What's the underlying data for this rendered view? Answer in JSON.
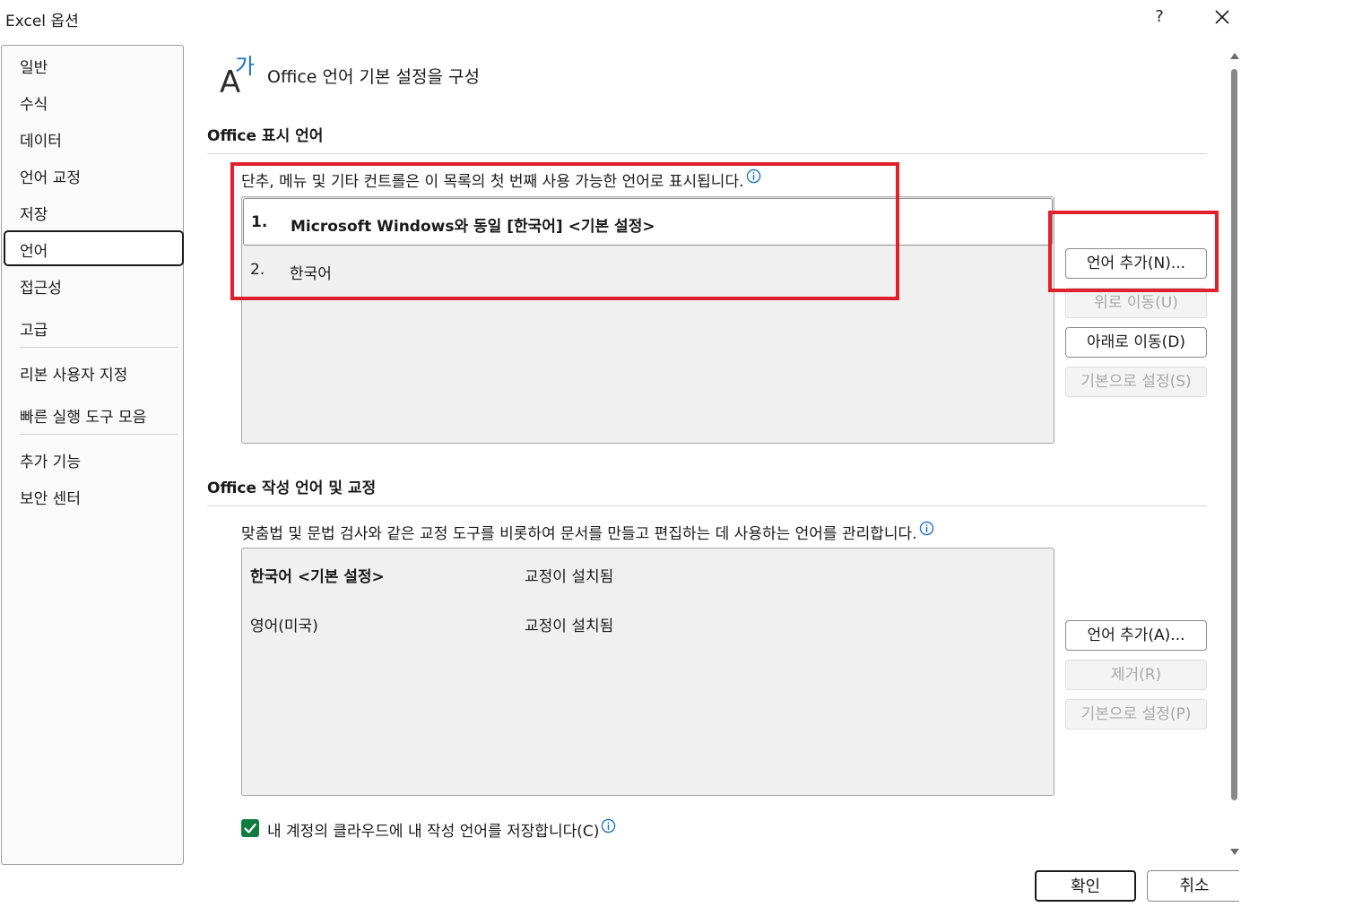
{
  "window": {
    "title": "Excel 옵션",
    "help_label": "?",
    "close_icon": "close-icon"
  },
  "sidebar": {
    "items": [
      {
        "label": "일반"
      },
      {
        "label": "수식"
      },
      {
        "label": "데이터"
      },
      {
        "label": "언어 교정"
      },
      {
        "label": "저장"
      },
      {
        "label": "언어",
        "selected": true
      },
      {
        "label": "접근성"
      },
      {
        "label": "고급"
      },
      {
        "label": "리본 사용자 지정"
      },
      {
        "label": "빠른 실행 도구 모음"
      },
      {
        "label": "추가 기능"
      },
      {
        "label": "보안 센터"
      }
    ]
  },
  "header": {
    "icon": "language-icon",
    "icon_glyph_latin": "A",
    "icon_glyph_korean": "가",
    "title": "Office 언어 기본 설정을 구성"
  },
  "display_language": {
    "section_title": "Office 표시 언어",
    "description": "단추, 메뉴 및 기타 컨트롤은 이 목록의 첫 번째 사용 가능한 언어로 표시됩니다.",
    "list": [
      {
        "index": "1.",
        "name": "Microsoft Windows와 동일 [한국어] <기본 설정>",
        "selected": true
      },
      {
        "index": "2.",
        "name": "한국어",
        "selected": false
      }
    ],
    "buttons": {
      "add": {
        "label": "언어 추가(N)...",
        "enabled": true
      },
      "move_up": {
        "label": "위로 이동(U)",
        "enabled": false
      },
      "move_down": {
        "label": "아래로 이동(D)",
        "enabled": true
      },
      "set_default": {
        "label": "기본으로 설정(S)",
        "enabled": false
      }
    }
  },
  "authoring_language": {
    "section_title": "Office 작성 언어 및 교정",
    "description": "맞춤법 및 문법 검사와 같은 교정 도구를 비롯하여 문서를 만들고 편집하는 데 사용하는 언어를 관리합니다.",
    "list": [
      {
        "name": "한국어 <기본 설정>",
        "status": "교정이 설치됨",
        "default": true
      },
      {
        "name": "영어(미국)",
        "status": "교정이 설치됨",
        "default": false
      }
    ],
    "buttons": {
      "add": {
        "label": "언어 추가(A)...",
        "enabled": true
      },
      "remove": {
        "label": "제거(R)",
        "enabled": false
      },
      "set_default": {
        "label": "기본으로 설정(P)",
        "enabled": false
      }
    }
  },
  "cloud_save": {
    "label": "내 계정의 클라우드에 내 작성 언어를 저장합니다(C)",
    "checked": true
  },
  "footer": {
    "ok_label": "확인",
    "cancel_label": "취소"
  },
  "colors": {
    "highlight_box": "#e0212c",
    "checkbox": "#107c41",
    "info_icon": "#1b6ec2"
  }
}
